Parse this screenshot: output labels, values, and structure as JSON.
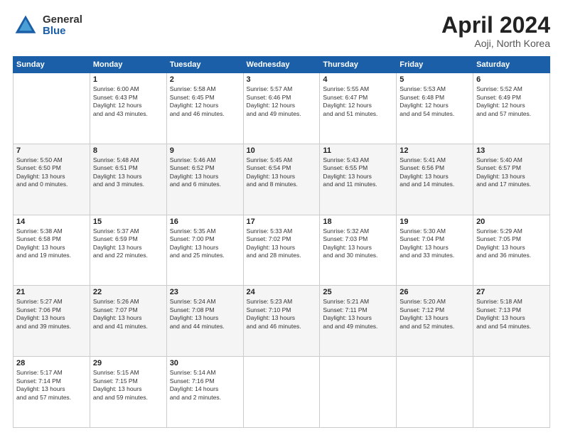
{
  "header": {
    "logo_general": "General",
    "logo_blue": "Blue",
    "month_title": "April 2024",
    "location": "Aoji, North Korea"
  },
  "weekdays": [
    "Sunday",
    "Monday",
    "Tuesday",
    "Wednesday",
    "Thursday",
    "Friday",
    "Saturday"
  ],
  "weeks": [
    [
      {
        "day": "",
        "sunrise": "",
        "sunset": "",
        "daylight": ""
      },
      {
        "day": "1",
        "sunrise": "Sunrise: 6:00 AM",
        "sunset": "Sunset: 6:43 PM",
        "daylight": "Daylight: 12 hours and 43 minutes."
      },
      {
        "day": "2",
        "sunrise": "Sunrise: 5:58 AM",
        "sunset": "Sunset: 6:45 PM",
        "daylight": "Daylight: 12 hours and 46 minutes."
      },
      {
        "day": "3",
        "sunrise": "Sunrise: 5:57 AM",
        "sunset": "Sunset: 6:46 PM",
        "daylight": "Daylight: 12 hours and 49 minutes."
      },
      {
        "day": "4",
        "sunrise": "Sunrise: 5:55 AM",
        "sunset": "Sunset: 6:47 PM",
        "daylight": "Daylight: 12 hours and 51 minutes."
      },
      {
        "day": "5",
        "sunrise": "Sunrise: 5:53 AM",
        "sunset": "Sunset: 6:48 PM",
        "daylight": "Daylight: 12 hours and 54 minutes."
      },
      {
        "day": "6",
        "sunrise": "Sunrise: 5:52 AM",
        "sunset": "Sunset: 6:49 PM",
        "daylight": "Daylight: 12 hours and 57 minutes."
      }
    ],
    [
      {
        "day": "7",
        "sunrise": "Sunrise: 5:50 AM",
        "sunset": "Sunset: 6:50 PM",
        "daylight": "Daylight: 13 hours and 0 minutes."
      },
      {
        "day": "8",
        "sunrise": "Sunrise: 5:48 AM",
        "sunset": "Sunset: 6:51 PM",
        "daylight": "Daylight: 13 hours and 3 minutes."
      },
      {
        "day": "9",
        "sunrise": "Sunrise: 5:46 AM",
        "sunset": "Sunset: 6:52 PM",
        "daylight": "Daylight: 13 hours and 6 minutes."
      },
      {
        "day": "10",
        "sunrise": "Sunrise: 5:45 AM",
        "sunset": "Sunset: 6:54 PM",
        "daylight": "Daylight: 13 hours and 8 minutes."
      },
      {
        "day": "11",
        "sunrise": "Sunrise: 5:43 AM",
        "sunset": "Sunset: 6:55 PM",
        "daylight": "Daylight: 13 hours and 11 minutes."
      },
      {
        "day": "12",
        "sunrise": "Sunrise: 5:41 AM",
        "sunset": "Sunset: 6:56 PM",
        "daylight": "Daylight: 13 hours and 14 minutes."
      },
      {
        "day": "13",
        "sunrise": "Sunrise: 5:40 AM",
        "sunset": "Sunset: 6:57 PM",
        "daylight": "Daylight: 13 hours and 17 minutes."
      }
    ],
    [
      {
        "day": "14",
        "sunrise": "Sunrise: 5:38 AM",
        "sunset": "Sunset: 6:58 PM",
        "daylight": "Daylight: 13 hours and 19 minutes."
      },
      {
        "day": "15",
        "sunrise": "Sunrise: 5:37 AM",
        "sunset": "Sunset: 6:59 PM",
        "daylight": "Daylight: 13 hours and 22 minutes."
      },
      {
        "day": "16",
        "sunrise": "Sunrise: 5:35 AM",
        "sunset": "Sunset: 7:00 PM",
        "daylight": "Daylight: 13 hours and 25 minutes."
      },
      {
        "day": "17",
        "sunrise": "Sunrise: 5:33 AM",
        "sunset": "Sunset: 7:02 PM",
        "daylight": "Daylight: 13 hours and 28 minutes."
      },
      {
        "day": "18",
        "sunrise": "Sunrise: 5:32 AM",
        "sunset": "Sunset: 7:03 PM",
        "daylight": "Daylight: 13 hours and 30 minutes."
      },
      {
        "day": "19",
        "sunrise": "Sunrise: 5:30 AM",
        "sunset": "Sunset: 7:04 PM",
        "daylight": "Daylight: 13 hours and 33 minutes."
      },
      {
        "day": "20",
        "sunrise": "Sunrise: 5:29 AM",
        "sunset": "Sunset: 7:05 PM",
        "daylight": "Daylight: 13 hours and 36 minutes."
      }
    ],
    [
      {
        "day": "21",
        "sunrise": "Sunrise: 5:27 AM",
        "sunset": "Sunset: 7:06 PM",
        "daylight": "Daylight: 13 hours and 39 minutes."
      },
      {
        "day": "22",
        "sunrise": "Sunrise: 5:26 AM",
        "sunset": "Sunset: 7:07 PM",
        "daylight": "Daylight: 13 hours and 41 minutes."
      },
      {
        "day": "23",
        "sunrise": "Sunrise: 5:24 AM",
        "sunset": "Sunset: 7:08 PM",
        "daylight": "Daylight: 13 hours and 44 minutes."
      },
      {
        "day": "24",
        "sunrise": "Sunrise: 5:23 AM",
        "sunset": "Sunset: 7:10 PM",
        "daylight": "Daylight: 13 hours and 46 minutes."
      },
      {
        "day": "25",
        "sunrise": "Sunrise: 5:21 AM",
        "sunset": "Sunset: 7:11 PM",
        "daylight": "Daylight: 13 hours and 49 minutes."
      },
      {
        "day": "26",
        "sunrise": "Sunrise: 5:20 AM",
        "sunset": "Sunset: 7:12 PM",
        "daylight": "Daylight: 13 hours and 52 minutes."
      },
      {
        "day": "27",
        "sunrise": "Sunrise: 5:18 AM",
        "sunset": "Sunset: 7:13 PM",
        "daylight": "Daylight: 13 hours and 54 minutes."
      }
    ],
    [
      {
        "day": "28",
        "sunrise": "Sunrise: 5:17 AM",
        "sunset": "Sunset: 7:14 PM",
        "daylight": "Daylight: 13 hours and 57 minutes."
      },
      {
        "day": "29",
        "sunrise": "Sunrise: 5:15 AM",
        "sunset": "Sunset: 7:15 PM",
        "daylight": "Daylight: 13 hours and 59 minutes."
      },
      {
        "day": "30",
        "sunrise": "Sunrise: 5:14 AM",
        "sunset": "Sunset: 7:16 PM",
        "daylight": "Daylight: 14 hours and 2 minutes."
      },
      {
        "day": "",
        "sunrise": "",
        "sunset": "",
        "daylight": ""
      },
      {
        "day": "",
        "sunrise": "",
        "sunset": "",
        "daylight": ""
      },
      {
        "day": "",
        "sunrise": "",
        "sunset": "",
        "daylight": ""
      },
      {
        "day": "",
        "sunrise": "",
        "sunset": "",
        "daylight": ""
      }
    ]
  ]
}
